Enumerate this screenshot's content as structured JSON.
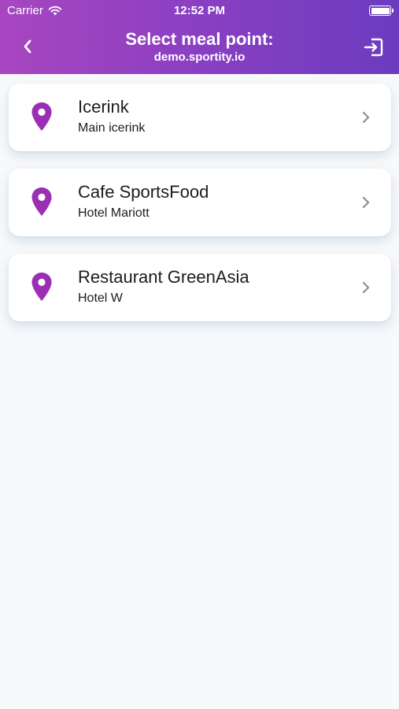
{
  "status_bar": {
    "carrier": "Carrier",
    "time": "12:52 PM",
    "wifi_icon": "wifi-icon",
    "battery_icon": "battery-icon"
  },
  "header": {
    "title": "Select meal point:",
    "subtitle": "demo.sportity.io",
    "back_icon": "chevron-left-icon",
    "logout_icon": "logout-icon",
    "gradient_start": "#a846c0",
    "gradient_end": "#6b3cc0"
  },
  "meal_points": [
    {
      "name": "Icerink",
      "location": "Main icerink"
    },
    {
      "name": "Cafe SportsFood",
      "location": "Hotel Mariott"
    },
    {
      "name": "Restaurant GreenAsia",
      "location": "Hotel W"
    }
  ],
  "colors": {
    "pin": "#9b2fb3",
    "chevron": "#8e8e93",
    "background": "#f8f9fa"
  },
  "icons": {
    "pin": "map-pin-icon",
    "chevron": "chevron-right-icon"
  }
}
